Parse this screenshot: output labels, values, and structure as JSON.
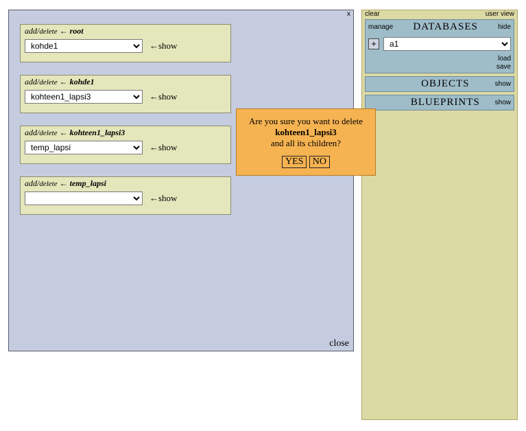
{
  "main": {
    "x_label": "x",
    "close_label": "close",
    "cards": [
      {
        "add": "add",
        "slash": "/",
        "del": "delete",
        "arrow": "←",
        "name": "root",
        "selected": "kohde1",
        "show": "←show"
      },
      {
        "add": "add",
        "slash": "/",
        "del": "delete",
        "arrow": "←",
        "name": "kohde1",
        "selected": "kohteen1_lapsi3",
        "show": "←show"
      },
      {
        "add": "add",
        "slash": "/",
        "del": "delete",
        "arrow": "←",
        "name": "kohteen1_lapsi3",
        "selected": "temp_lapsi",
        "show": "←show"
      },
      {
        "add": "add",
        "slash": "/",
        "del": "delete",
        "arrow": "←",
        "name": "temp_lapsi",
        "selected": "",
        "show": "←show"
      }
    ]
  },
  "sidebar": {
    "clear": "clear",
    "userview": "user view",
    "databases": {
      "manage": "manage",
      "title": "DATABASES",
      "hide": "hide",
      "plus": "+",
      "selected": "a1",
      "load": "load",
      "save": "save"
    },
    "objects": {
      "title": "OBJECTS",
      "show": "show"
    },
    "blueprints": {
      "title": "BLUEPRINTS",
      "show": "show"
    }
  },
  "dialog": {
    "line1": "Are you sure you want to delete",
    "target": "kohteen1_lapsi3",
    "line2": "and all its children?",
    "yes": "YES",
    "no": "NO"
  }
}
